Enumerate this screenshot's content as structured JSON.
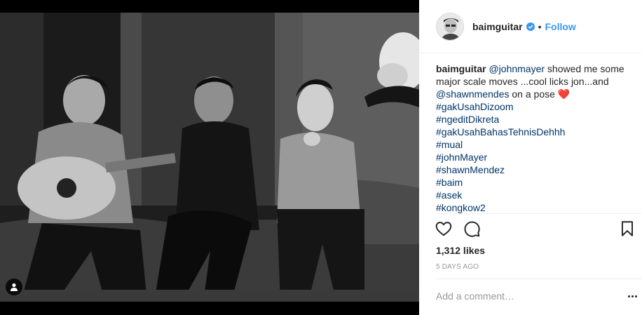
{
  "header": {
    "username": "baimguitar",
    "verified_icon": "verified-badge-icon",
    "separator": "•",
    "follow_label": "Follow"
  },
  "caption": {
    "author": "baimguitar",
    "mention_1": "@johnmayer",
    "text_1": " showed me some major scale moves ...cool licks jon...and ",
    "mention_2": "@shawnmendes",
    "text_2": " on a pose ",
    "emoji": "❤️",
    "hashtags": [
      "#gakUsahDizoom",
      "#ngeditDikreta",
      "#gakUsahBahasTehnisDehhh",
      "#mual",
      "#johnMayer",
      "#shawnMendez",
      "#baim",
      "#asek",
      "#kongkow2"
    ]
  },
  "actions": {
    "like_icon": "heart-icon",
    "comment_icon": "comment-icon",
    "save_icon": "bookmark-icon"
  },
  "likes": "1,312 likes",
  "time": "5 DAYS AGO",
  "comment": {
    "placeholder": "Add a comment…"
  },
  "colors": {
    "link": "#003569",
    "follow": "#3897f0",
    "muted": "#999999",
    "text": "#262626"
  }
}
